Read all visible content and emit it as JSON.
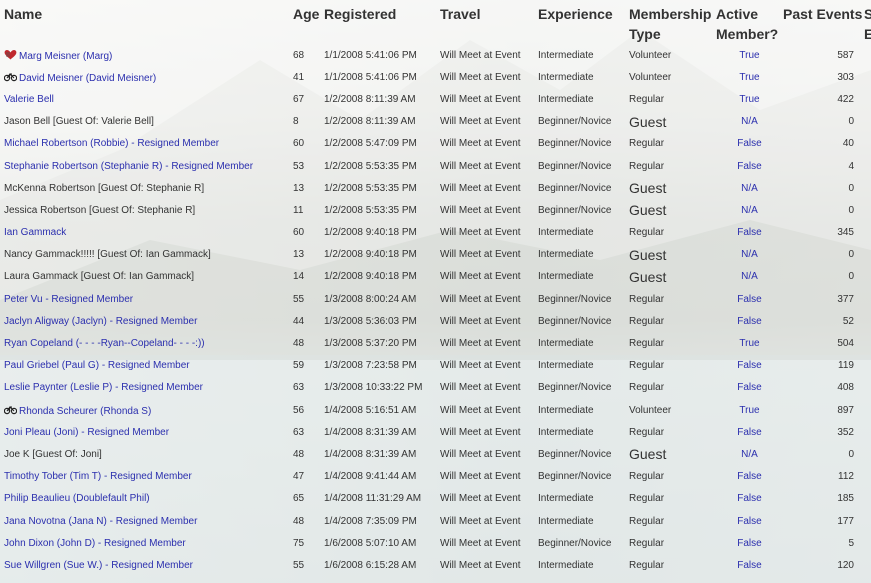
{
  "headers": {
    "name": "Name",
    "age": "Age",
    "registered": "Registered",
    "travel": "Travel",
    "experience": "Experience",
    "membership_type": "Membership Type",
    "active_member": "Active Member?",
    "past_events": "Past Events",
    "extra": "S E"
  },
  "rows": [
    {
      "icon": "heart-icon",
      "name": "Marg Meisner (Marg)",
      "link": true,
      "age": "68",
      "registered": "1/1/2008 5:41:06 PM",
      "travel": "Will Meet at Event",
      "experience": "Intermediate",
      "type": "Volunteer",
      "guest": false,
      "active": "True",
      "past": "587"
    },
    {
      "icon": "bike-icon",
      "name": "David Meisner (David Meisner)",
      "link": true,
      "age": "41",
      "registered": "1/1/2008 5:41:06 PM",
      "travel": "Will Meet at Event",
      "experience": "Intermediate",
      "type": "Volunteer",
      "guest": false,
      "active": "True",
      "past": "303"
    },
    {
      "icon": "",
      "name": "Valerie Bell",
      "link": true,
      "age": "67",
      "registered": "1/2/2008 8:11:39 AM",
      "travel": "Will Meet at Event",
      "experience": "Intermediate",
      "type": "Regular",
      "guest": false,
      "active": "True",
      "past": "422"
    },
    {
      "icon": "",
      "name": "Jason Bell [Guest Of: Valerie Bell]",
      "link": false,
      "age": "8",
      "registered": "1/2/2008 8:11:39 AM",
      "travel": "Will Meet at Event",
      "experience": "Beginner/Novice",
      "type": "Guest",
      "guest": true,
      "active": "N/A",
      "past": "0"
    },
    {
      "icon": "",
      "name": "Michael Robertson (Robbie) - Resigned Member",
      "link": true,
      "age": "60",
      "registered": "1/2/2008 5:47:09 PM",
      "travel": "Will Meet at Event",
      "experience": "Beginner/Novice",
      "type": "Regular",
      "guest": false,
      "active": "False",
      "past": "40"
    },
    {
      "icon": "",
      "name": "Stephanie Robertson (Stephanie R) - Resigned Member",
      "link": true,
      "age": "53",
      "registered": "1/2/2008 5:53:35 PM",
      "travel": "Will Meet at Event",
      "experience": "Beginner/Novice",
      "type": "Regular",
      "guest": false,
      "active": "False",
      "past": "4"
    },
    {
      "icon": "",
      "name": "McKenna Robertson [Guest Of: Stephanie R]",
      "link": false,
      "age": "13",
      "registered": "1/2/2008 5:53:35 PM",
      "travel": "Will Meet at Event",
      "experience": "Beginner/Novice",
      "type": "Guest",
      "guest": true,
      "active": "N/A",
      "past": "0"
    },
    {
      "icon": "",
      "name": "Jessica Robertson [Guest Of: Stephanie R]",
      "link": false,
      "age": "11",
      "registered": "1/2/2008 5:53:35 PM",
      "travel": "Will Meet at Event",
      "experience": "Beginner/Novice",
      "type": "Guest",
      "guest": true,
      "active": "N/A",
      "past": "0"
    },
    {
      "icon": "",
      "name": "Ian Gammack",
      "link": true,
      "age": "60",
      "registered": "1/2/2008 9:40:18 PM",
      "travel": "Will Meet at Event",
      "experience": "Intermediate",
      "type": "Regular",
      "guest": false,
      "active": "False",
      "past": "345"
    },
    {
      "icon": "",
      "name": "Nancy Gammack!!!!! [Guest Of: Ian Gammack]",
      "link": false,
      "age": "13",
      "registered": "1/2/2008 9:40:18 PM",
      "travel": "Will Meet at Event",
      "experience": "Intermediate",
      "type": "Guest",
      "guest": true,
      "active": "N/A",
      "past": "0"
    },
    {
      "icon": "",
      "name": "Laura Gammack [Guest Of: Ian Gammack]",
      "link": false,
      "age": "14",
      "registered": "1/2/2008 9:40:18 PM",
      "travel": "Will Meet at Event",
      "experience": "Intermediate",
      "type": "Guest",
      "guest": true,
      "active": "N/A",
      "past": "0"
    },
    {
      "icon": "",
      "name": "Peter Vu - Resigned Member",
      "link": true,
      "age": "55",
      "registered": "1/3/2008 8:00:24 AM",
      "travel": "Will Meet at Event",
      "experience": "Beginner/Novice",
      "type": "Regular",
      "guest": false,
      "active": "False",
      "past": "377"
    },
    {
      "icon": "",
      "name": "Jaclyn Aligway (Jaclyn) - Resigned Member",
      "link": true,
      "age": "44",
      "registered": "1/3/2008 5:36:03 PM",
      "travel": "Will Meet at Event",
      "experience": "Beginner/Novice",
      "type": "Regular",
      "guest": false,
      "active": "False",
      "past": "52"
    },
    {
      "icon": "",
      "name": "Ryan Copeland (- - - -Ryan--Copeland- - - -:))",
      "link": true,
      "age": "48",
      "registered": "1/3/2008 5:37:20 PM",
      "travel": "Will Meet at Event",
      "experience": "Intermediate",
      "type": "Regular",
      "guest": false,
      "active": "True",
      "past": "504"
    },
    {
      "icon": "",
      "name": "Paul Griebel (Paul G) - Resigned Member",
      "link": true,
      "age": "59",
      "registered": "1/3/2008 7:23:58 PM",
      "travel": "Will Meet at Event",
      "experience": "Intermediate",
      "type": "Regular",
      "guest": false,
      "active": "False",
      "past": "119"
    },
    {
      "icon": "",
      "name": "Leslie Paynter (Leslie P) - Resigned Member",
      "link": true,
      "age": "63",
      "registered": "1/3/2008 10:33:22 PM",
      "travel": "Will Meet at Event",
      "experience": "Beginner/Novice",
      "type": "Regular",
      "guest": false,
      "active": "False",
      "past": "408"
    },
    {
      "icon": "bike-icon",
      "name": "Rhonda Scheurer (Rhonda S)",
      "link": true,
      "age": "56",
      "registered": "1/4/2008 5:16:51 AM",
      "travel": "Will Meet at Event",
      "experience": "Intermediate",
      "type": "Volunteer",
      "guest": false,
      "active": "True",
      "past": "897"
    },
    {
      "icon": "",
      "name": "Joni Pleau (Joni) - Resigned Member",
      "link": true,
      "age": "63",
      "registered": "1/4/2008 8:31:39 AM",
      "travel": "Will Meet at Event",
      "experience": "Intermediate",
      "type": "Regular",
      "guest": false,
      "active": "False",
      "past": "352"
    },
    {
      "icon": "",
      "name": "Joe K [Guest Of: Joni]",
      "link": false,
      "age": "48",
      "registered": "1/4/2008 8:31:39 AM",
      "travel": "Will Meet at Event",
      "experience": "Beginner/Novice",
      "type": "Guest",
      "guest": true,
      "active": "N/A",
      "past": "0"
    },
    {
      "icon": "",
      "name": "Timothy Tober (Tim T) - Resigned Member",
      "link": true,
      "age": "47",
      "registered": "1/4/2008 9:41:44 AM",
      "travel": "Will Meet at Event",
      "experience": "Beginner/Novice",
      "type": "Regular",
      "guest": false,
      "active": "False",
      "past": "112"
    },
    {
      "icon": "",
      "name": "Philip Beaulieu (Doublefault Phil)",
      "link": true,
      "age": "65",
      "registered": "1/4/2008 11:31:29 AM",
      "travel": "Will Meet at Event",
      "experience": "Intermediate",
      "type": "Regular",
      "guest": false,
      "active": "False",
      "past": "185"
    },
    {
      "icon": "",
      "name": "Jana Novotna (Jana N) - Resigned Member",
      "link": true,
      "age": "48",
      "registered": "1/4/2008 7:35:09 PM",
      "travel": "Will Meet at Event",
      "experience": "Intermediate",
      "type": "Regular",
      "guest": false,
      "active": "False",
      "past": "177"
    },
    {
      "icon": "",
      "name": "John Dixon (John D) - Resigned Member",
      "link": true,
      "age": "75",
      "registered": "1/6/2008 5:07:10 AM",
      "travel": "Will Meet at Event",
      "experience": "Beginner/Novice",
      "type": "Regular",
      "guest": false,
      "active": "False",
      "past": "5"
    },
    {
      "icon": "",
      "name": "Sue Willgren (Sue W.) - Resigned Member",
      "link": true,
      "age": "55",
      "registered": "1/6/2008 6:15:28 AM",
      "travel": "Will Meet at Event",
      "experience": "Intermediate",
      "type": "Regular",
      "guest": false,
      "active": "False",
      "past": "120"
    }
  ],
  "colors": {
    "link": "#2b2fae",
    "text": "#333333",
    "heart": "#c0282d"
  }
}
